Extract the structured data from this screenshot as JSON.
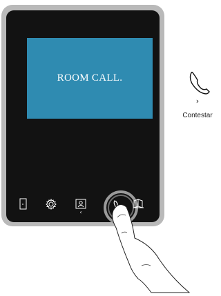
{
  "screen": {
    "message": "ROOM CALL."
  },
  "buttons": [
    {
      "icon": "door-icon"
    },
    {
      "icon": "gear-icon"
    },
    {
      "icon": "contacts-icon"
    },
    {
      "icon": "phone-icon"
    },
    {
      "icon": "book-icon"
    }
  ],
  "legend": {
    "icon": "phone-icon",
    "chevron": "›",
    "label": "Contestar"
  },
  "colors": {
    "bezel": "#b9b9b9",
    "panel": "#121212",
    "screen": "#2f8bb1",
    "text": "#ffffff"
  }
}
